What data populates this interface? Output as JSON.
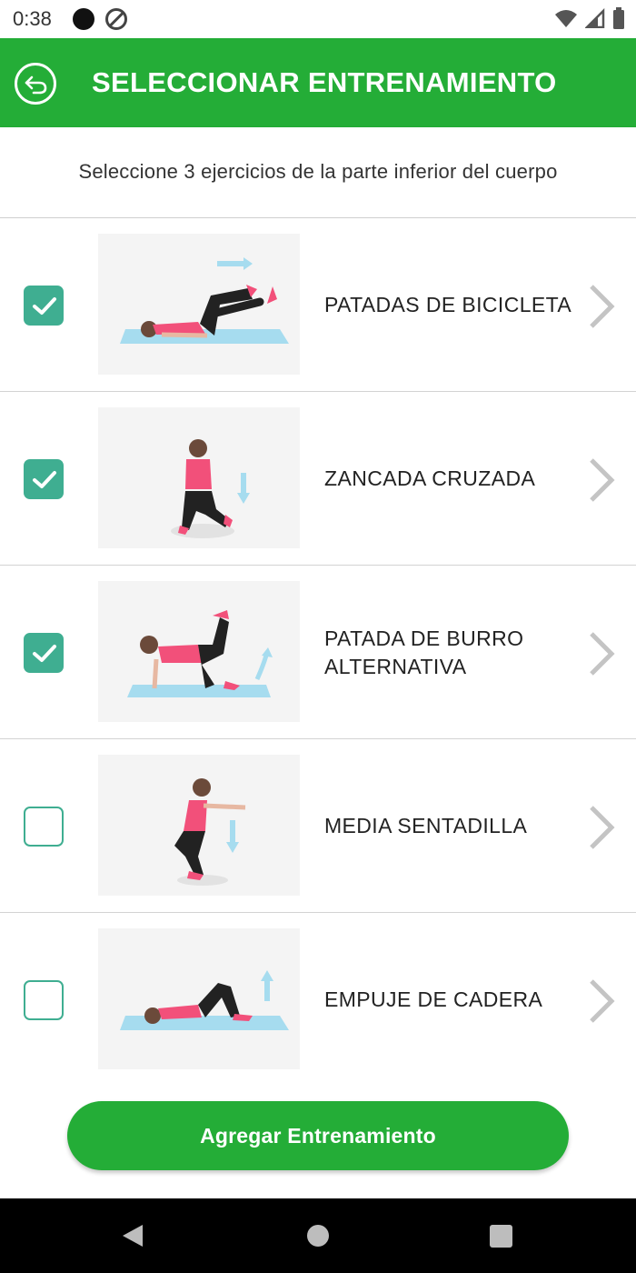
{
  "status_bar": {
    "time": "0:38"
  },
  "header": {
    "title": "SELECCIONAR ENTRENAMIENTO",
    "back_icon": "back-arrow-icon"
  },
  "instruction": "Seleccione 3 ejercicios de la parte inferior del cuerpo",
  "exercises": [
    {
      "name": "PATADAS DE BICICLETA",
      "checked": true
    },
    {
      "name": "ZANCADA CRUZADA",
      "checked": true
    },
    {
      "name": "PATADA DE BURRO ALTERNATIVA",
      "checked": true
    },
    {
      "name": "MEDIA SENTADILLA",
      "checked": false
    },
    {
      "name": "EMPUJE DE CADERA",
      "checked": false
    }
  ],
  "add_button": {
    "label": "Agregar Entrenamiento"
  },
  "colors": {
    "primary": "#24ad37",
    "checkbox": "#3fae91"
  }
}
